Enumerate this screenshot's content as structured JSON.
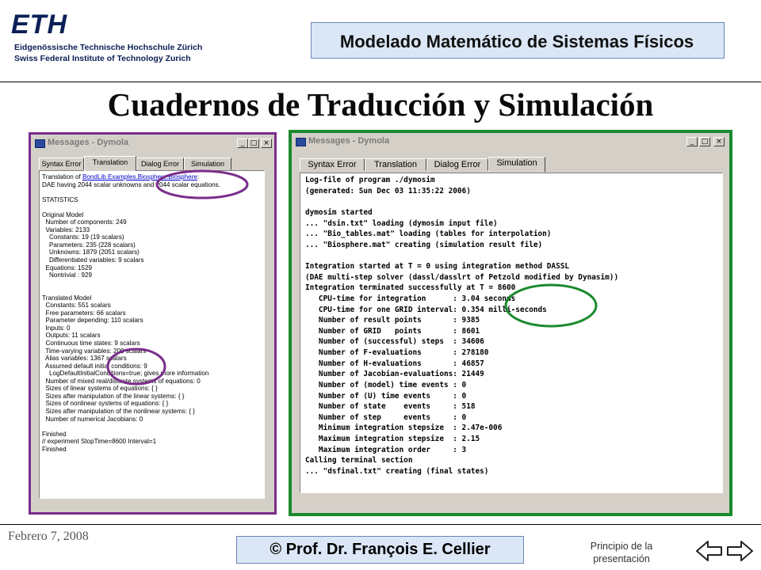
{
  "header": {
    "logo_word": "ETH",
    "institution_de": "Eidgenössische Technische Hochschule Zürich",
    "institution_en": "Swiss Federal Institute of Technology Zurich",
    "course_title": "Modelado Matemático de Sistemas Físicos"
  },
  "slide_title": "Cuadernos de Traducción y Simulación",
  "left_window": {
    "title": "Messages - Dymola",
    "controls": [
      "_",
      "□",
      "×"
    ],
    "tabs": [
      "Syntax Error",
      "Translation",
      "Dialog Error",
      "Simulation"
    ],
    "active_tab": "Translation",
    "link_prefix": "Translation of ",
    "link_text": "BondLib.Examples.Biosphere.Biosphere",
    "link_suffix": ":",
    "lines": [
      "DAE having 2044 scalar unknowns and 2044 scalar equations.",
      "",
      "STATISTICS",
      "",
      "Original Model",
      "  Number of components: 249",
      "  Variables: 2133",
      "    Constants: 19 (19 scalars)",
      "    Parameters: 235 (228 scalars)",
      "    Unknowns: 1879 (2051 scalars)",
      "    Differentiated variables: 9 scalars",
      "  Equations: 1529",
      "    Nontrivial : 929",
      "",
      "",
      "Translated Model",
      "  Constants: 551 scalars",
      "  Free parameters: 66 scalars",
      "  Parameter depending: 110 scalars",
      "  Inputs: 0",
      "  Outputs: 11 scalars",
      "  Continuous time states: 9 scalars",
      "  Time-varying variables: 209 scalars",
      "  Alias variables: 1367 scalars",
      "  Assumed default initial conditions: 9",
      "    LogDefaultInitialConditions=true; gives more information",
      "  Number of mixed real/discrete systems of equations: 0",
      "  Sizes of linear systems of equations: { }",
      "  Sizes after manipulation of the linear systems: { }",
      "  Sizes of nonlinear systems of equations: { }",
      "  Sizes after manipulation of the nonlinear systems: { }",
      "  Number of numerical Jacobians: 0",
      "",
      "Finished",
      "// experiment StopTime=8600 Interval=1",
      "Finished"
    ]
  },
  "right_window": {
    "title": "Messages - Dymola",
    "controls": [
      "_",
      "□",
      "×"
    ],
    "tabs": [
      "Syntax Error",
      "Translation",
      "Dialog Error",
      "Simulation"
    ],
    "active_tab": "Simulation",
    "lines": [
      "Log-file of program ./dymosim",
      "(generated: Sun Dec 03 11:35:22 2006)",
      "",
      "dymosim started",
      "... \"dsin.txt\" loading (dymosim input file)",
      "... \"Bio_tables.mat\" loading (tables for interpolation)",
      "... \"Biosphere.mat\" creating (simulation result file)",
      "",
      "Integration started at T = 0 using integration method DASSL",
      "(DAE multi-step solver (dassl/dasslrt of Petzold modified by Dynasim))",
      "Integration terminated successfully at T = 8600",
      "   CPU-time for integration      : 3.04 seconds",
      "   CPU-time for one GRID interval: 0.354 milli-seconds",
      "   Number of result points       : 9385",
      "   Number of GRID   points       : 8601",
      "   Number of (successful) steps  : 34606",
      "   Number of F-evaluations       : 278180",
      "   Number of H-evaluations       : 46857",
      "   Number of Jacobian-evaluations: 21449",
      "   Number of (model) time events : 0",
      "   Number of (U) time events     : 0",
      "   Number of state    events     : 518",
      "   Number of step     events     : 0",
      "   Minimum integration stepsize  : 2.47e-006",
      "   Maximum integration stepsize  : 2.15",
      "   Maximum integration order     : 3",
      "Calling terminal section",
      "... \"dsfinal.txt\" creating (final states)"
    ]
  },
  "footer": {
    "date": "Febrero 7, 2008",
    "author": "© Prof. Dr. François E. Cellier",
    "home_link": "Principio de la presentación"
  },
  "colors": {
    "left_frame": "#7b2d8b",
    "right_frame": "#1a8a2e",
    "box_fill": "#dbe7f6",
    "eth_blue": "#0b1f55"
  },
  "icons": [
    "window-icon",
    "minimize-icon",
    "maximize-icon",
    "close-icon",
    "nav-back-arrow-icon",
    "nav-forward-arrow-icon"
  ]
}
